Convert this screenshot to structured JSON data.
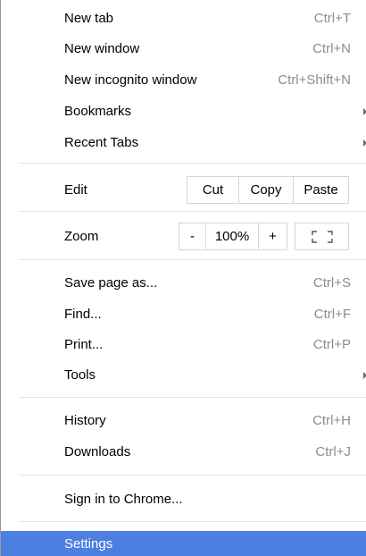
{
  "menu": {
    "new_tab": {
      "label": "New tab",
      "shortcut": "Ctrl+T"
    },
    "new_window": {
      "label": "New window",
      "shortcut": "Ctrl+N"
    },
    "new_incognito": {
      "label": "New incognito window",
      "shortcut": "Ctrl+Shift+N"
    },
    "bookmarks": {
      "label": "Bookmarks"
    },
    "recent_tabs": {
      "label": "Recent Tabs"
    },
    "edit": {
      "label": "Edit",
      "cut": "Cut",
      "copy": "Copy",
      "paste": "Paste"
    },
    "zoom": {
      "label": "Zoom",
      "minus": "-",
      "level": "100%",
      "plus": "+"
    },
    "save_page": {
      "label": "Save page as...",
      "shortcut": "Ctrl+S"
    },
    "find": {
      "label": "Find...",
      "shortcut": "Ctrl+F"
    },
    "print": {
      "label": "Print...",
      "shortcut": "Ctrl+P"
    },
    "tools": {
      "label": "Tools"
    },
    "history": {
      "label": "History",
      "shortcut": "Ctrl+H"
    },
    "downloads": {
      "label": "Downloads",
      "shortcut": "Ctrl+J"
    },
    "sign_in": {
      "label": "Sign in to Chrome..."
    },
    "settings": {
      "label": "Settings"
    }
  },
  "colors": {
    "highlight": "#4d7fe0",
    "shortcut_text": "#8c8c8c",
    "separator": "#e4e4e4"
  },
  "icons": {
    "submenu": "chevron-right-icon",
    "fullscreen": "fullscreen-icon"
  }
}
